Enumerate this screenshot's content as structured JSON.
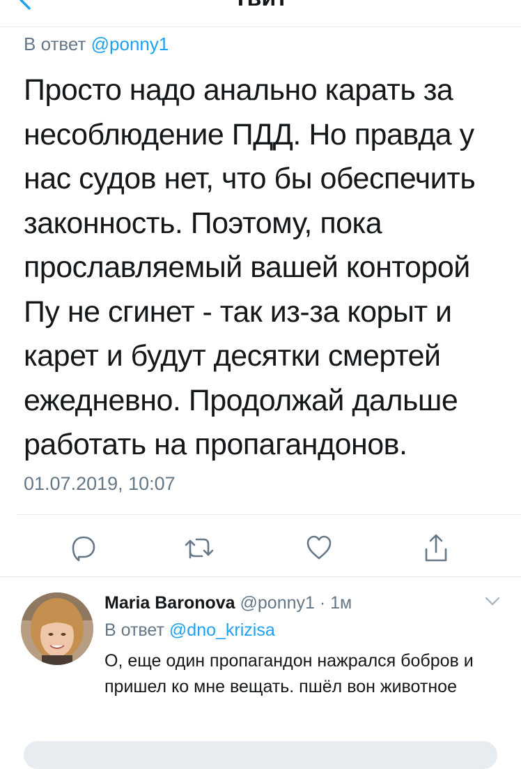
{
  "header": {
    "title": "Твит",
    "back_icon": "chevron-left-icon"
  },
  "tweet": {
    "reply_prefix": "В ответ",
    "reply_handle": "@ponny1",
    "text": "Просто надо анально карать за несоблюдение ПДД. Но правда у нас судов нет, что бы обеспечить законность. Поэтому, пока прославляемый вашей конторой Пу не сгинет - так из-за корыт и карет и будут десятки смертей ежедневно. Продолжай дальше работать на пропагандонов.",
    "timestamp": "01.07.2019, 10:07"
  },
  "actions": [
    {
      "name": "reply",
      "icon": "reply-icon"
    },
    {
      "name": "retweet",
      "icon": "retweet-icon"
    },
    {
      "name": "like",
      "icon": "heart-icon"
    },
    {
      "name": "share",
      "icon": "share-icon"
    }
  ],
  "reply": {
    "author_name": "Maria Baronova",
    "author_meta": "@ponny1 · 1м",
    "reply_prefix": "В ответ",
    "reply_handle": "@dno_krizisa",
    "text": "О, еще один пропагандон нажрался бобров и пришел ко мне вещать. пшёл вон животное"
  },
  "colors": {
    "accent": "#1da1f2",
    "secondary_text": "#657786",
    "divider": "#e1e8ed"
  }
}
